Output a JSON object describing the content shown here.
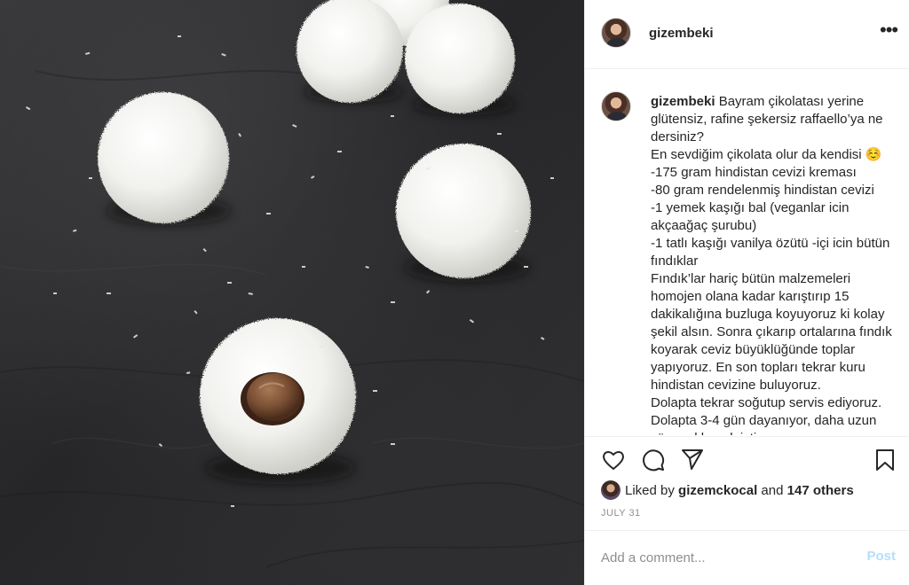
{
  "post": {
    "photo_alt": "",
    "username": "gizembeki",
    "more_icon": "more-horizontal-icon",
    "caption_user": "gizembeki",
    "caption_text": " Bayram çikolatası yerine glütensiz, rafine şekersiz raffaello’ya ne dersiniz?\nEn sevdiğim çikolata olur da kendisi ☺️\n-175 gram hindistan cevizi kreması\n-80 gram rendelenmiş hindistan cevizi\n-1 yemek kaşığı bal (veganlar icin akçaağaç şurubu)\n-1 tatlı kaşığı vanilya özütü -içi icin bütün fındıklar\nFındık’lar hariç bütün malzemeleri homojen olana kadar karıştırıp 15 dakikalığına buzluga koyuyoruz ki kolay şekil alsın. Sonra çıkarıp ortalarına fındık koyarak ceviz büyüklüğünde toplar yapıyoruz. En son topları tekrar kuru hindistan cevizine buluyoruz.\nDolapta tekrar soğutup servis ediyoruz.\nDolapta 3-4 gün dayanıyor, daha uzun süre saklamak istiyorsanız dondurabilirsiniz.",
    "likes": {
      "prefix": "Liked by ",
      "user": "gizemckocal",
      "middle": " and ",
      "count": "147 others"
    },
    "date": "JULY 31"
  },
  "actions": {
    "like_icon": "heart-icon",
    "comment_icon": "comment-icon",
    "share_icon": "paper-plane-icon",
    "save_icon": "bookmark-icon"
  },
  "comment_box": {
    "placeholder": "Add a comment...",
    "value": "",
    "post_label": "Post",
    "post_color_disabled": "#b2dffc"
  }
}
